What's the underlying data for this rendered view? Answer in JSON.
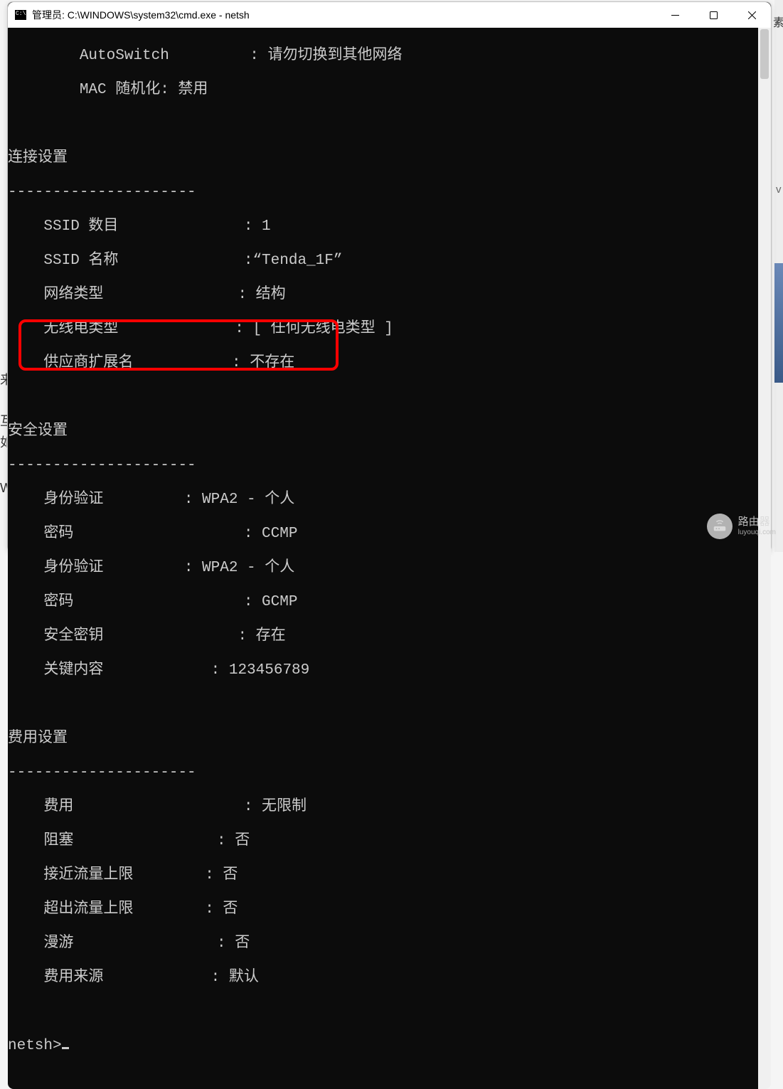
{
  "window": {
    "title": "管理员: C:\\WINDOWS\\system32\\cmd.exe - netsh"
  },
  "terminal": {
    "lines": {
      "l0": "        AutoSwitch         : 请勿切换到其他网络",
      "l1": "        MAC 随机化: 禁用",
      "l2": "",
      "l3": "连接设置",
      "l4": "---------------------",
      "l5": "    SSID 数目              : 1",
      "l6": "    SSID 名称              :“Tenda_1F”",
      "l7": "    网络类型               : 结构",
      "l8": "    无线电类型             : [ 任何无线电类型 ]",
      "l9": "    供应商扩展名           : 不存在",
      "l10": "",
      "l11": "安全设置",
      "l12": "---------------------",
      "l13": "    身份验证         : WPA2 - 个人",
      "l14": "    密码                   : CCMP",
      "l15": "    身份验证         : WPA2 - 个人",
      "l16": "    密码                   : GCMP",
      "l17": "    安全密钥               : 存在",
      "l18": "    关键内容            : 123456789",
      "l19": "",
      "l20": "费用设置",
      "l21": "---------------------",
      "l22": "    费用                   : 无限制",
      "l23": "    阻塞                : 否",
      "l24": "    接近流量上限        : 否",
      "l25": "    超出流量上限        : 否",
      "l26": "    漫游                : 否",
      "l27": "    费用来源            : 默认",
      "l28": "",
      "prompt": "netsh>"
    }
  },
  "watermark": {
    "label": "路由器",
    "sub": "luyouqi.com"
  },
  "behind": {
    "t0": "来",
    "t1": "互",
    "t2": "如",
    "t3": "W",
    "r0": "素",
    "r1": "v"
  }
}
